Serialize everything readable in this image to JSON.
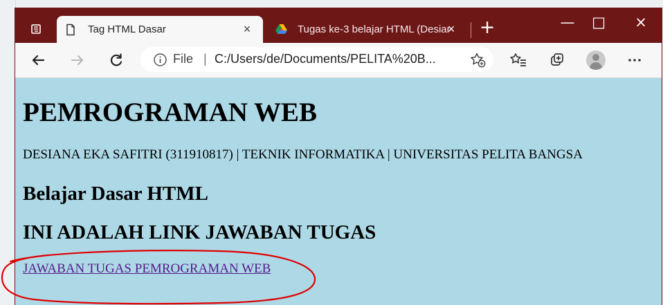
{
  "browser": {
    "tabs": [
      {
        "title": "Tag HTML Dasar",
        "close_label": "×",
        "icon": "page-icon",
        "active": true
      },
      {
        "title": "Tugas ke-3 belajar HTML (Desiana",
        "close_label": "×",
        "icon": "google-drive-icon",
        "active": false
      }
    ],
    "new_tab_label": "+",
    "window_controls": {
      "minimize": "—",
      "maximize": "□",
      "close": "×"
    },
    "address": {
      "scheme": "File",
      "separator": "|",
      "url": "C:/Users/de/Documents/PELITA%20B..."
    },
    "toolbar_icons": {
      "back": "back-arrow-icon",
      "forward": "forward-arrow-icon",
      "refresh": "refresh-icon",
      "info": "info-icon",
      "favorite_add": "add-favorite-icon",
      "favorites": "favorites-icon",
      "collections": "collections-icon",
      "profile": "profile-avatar-icon",
      "more": "more-icon"
    },
    "theme": {
      "titlebar": "#6d1717",
      "tab_active": "#f7f7f7",
      "page_background": "#add8e6",
      "visited_link": "#551a8b",
      "annotation_red": "#e00000"
    }
  },
  "page": {
    "heading": "PEMROGRAMAN WEB",
    "student_line": "DESIANA EKA SAFITRI (311910817) | TEKNIK INFORMATIKA | UNIVERSITAS PELITA BANGSA",
    "section_title": "Belajar Dasar HTML",
    "answer_title": "INI ADALAH LINK JAWABAN TUGAS",
    "answer_link": "JAWABAN TUGAS PEMROGRAMAN WEB"
  }
}
